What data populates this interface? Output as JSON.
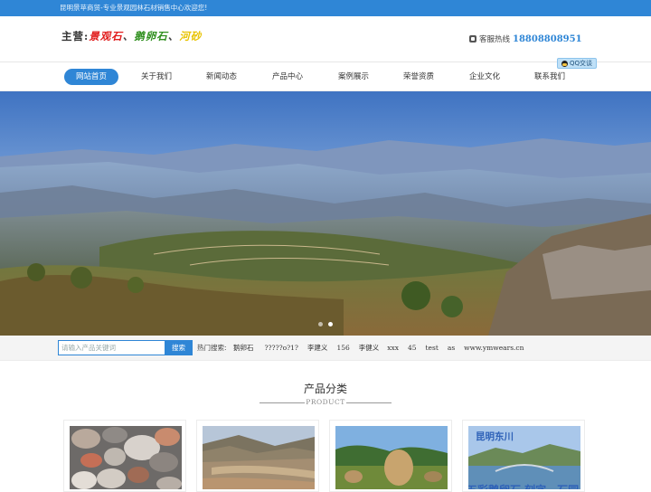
{
  "topbar": {
    "welcome": "昆明景苹商贸-专业景观园林石材销售中心欢迎您!"
  },
  "header": {
    "logo": {
      "lead": "主营:",
      "item1": "景观石",
      "sep1": "、",
      "item2": "鹅卵石",
      "sep2": "、",
      "item3": "河砂"
    },
    "hotline_label": "客服热线",
    "hotline_number": "18808808951",
    "qq_label": "QQ交谈"
  },
  "nav": {
    "items": [
      {
        "label": "网站首页",
        "active": true
      },
      {
        "label": "关于我们"
      },
      {
        "label": "新闻动态"
      },
      {
        "label": "产品中心"
      },
      {
        "label": "案例展示"
      },
      {
        "label": "荣誉资质"
      },
      {
        "label": "企业文化"
      },
      {
        "label": "联系我们"
      }
    ]
  },
  "banner": {
    "slides": 2,
    "active_slide": 2
  },
  "search": {
    "placeholder": "请输入产品关键词",
    "button": "搜索",
    "hot_label": "热门搜索:",
    "hot_words": [
      "鹅卵石",
      "?????o?1?",
      "李建义",
      "156",
      "李健义",
      "xxx",
      "45",
      "test",
      "as",
      "www.ymwears.cn"
    ]
  },
  "products": {
    "title": "产品分类",
    "subtitle": "PRODUCT",
    "card4_caption": "昆明东川",
    "card4_caption_bottom": "五彩鹅卵石 刻字、石园"
  },
  "colors": {
    "accent": "#2f86d6",
    "topbar": "#2f86d6"
  }
}
